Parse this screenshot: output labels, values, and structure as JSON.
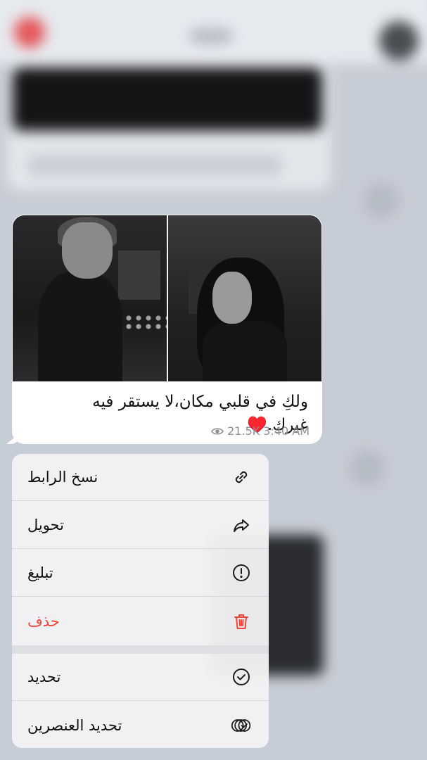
{
  "message": {
    "caption_line1": "ولكِ في قلبي مكان،لا يستقر فيه",
    "caption_line2": "غيركِ.♥️",
    "views": "21.5K",
    "time": "3:40 AM"
  },
  "menu": {
    "items": [
      {
        "label": "نسخ الرابط",
        "icon": "link-icon"
      },
      {
        "label": "تحويل",
        "icon": "forward-icon"
      },
      {
        "label": "تبليغ",
        "icon": "report-icon"
      },
      {
        "label": "حذف",
        "icon": "trash-icon",
        "color": "#f4453b"
      },
      {
        "label": "تحديد",
        "icon": "checkmark-circle-icon"
      },
      {
        "label": "تحديد العنصرين",
        "icon": "select-multiple-icon"
      }
    ]
  },
  "colors": {
    "danger": "#f4453b",
    "icon": "#1c1c1e",
    "meta": "#8e8e93"
  }
}
